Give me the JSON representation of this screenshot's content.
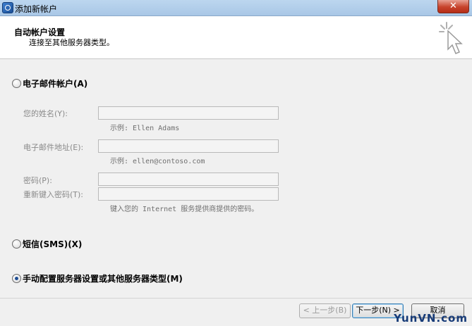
{
  "window": {
    "title": "添加新帐户",
    "close_glyph": "✕"
  },
  "header": {
    "title": "自动帐户设置",
    "subtitle": "连接至其他服务器类型。"
  },
  "options": {
    "email": {
      "label": "电子邮件帐户(A)",
      "checked": false
    },
    "sms": {
      "label": "短信(SMS)(X)",
      "checked": false
    },
    "manual": {
      "label": "手动配置服务器设置或其他服务器类型(M)",
      "checked": true
    }
  },
  "fields": {
    "name": {
      "label": "您的姓名(Y):",
      "value": "",
      "hint": "示例: Ellen Adams"
    },
    "email": {
      "label": "电子邮件地址(E):",
      "value": "",
      "hint": "示例: ellen@contoso.com"
    },
    "password": {
      "label": "密码(P):",
      "value": ""
    },
    "password_confirm": {
      "label": "重新键入密码(T):",
      "value": ""
    },
    "password_hint": "键入您的 Internet 服务提供商提供的密码。"
  },
  "buttons": {
    "back": "< 上一步(B)",
    "next": "下一步(N) >",
    "cancel": "取消"
  },
  "watermark": "YunVN.com",
  "icons": {
    "app": "account-icon",
    "wizard": "cursor-sparkle-icon"
  },
  "colors": {
    "accent": "#1f4d93",
    "titlebar": "#bcd6ef",
    "close": "#c7432c"
  }
}
